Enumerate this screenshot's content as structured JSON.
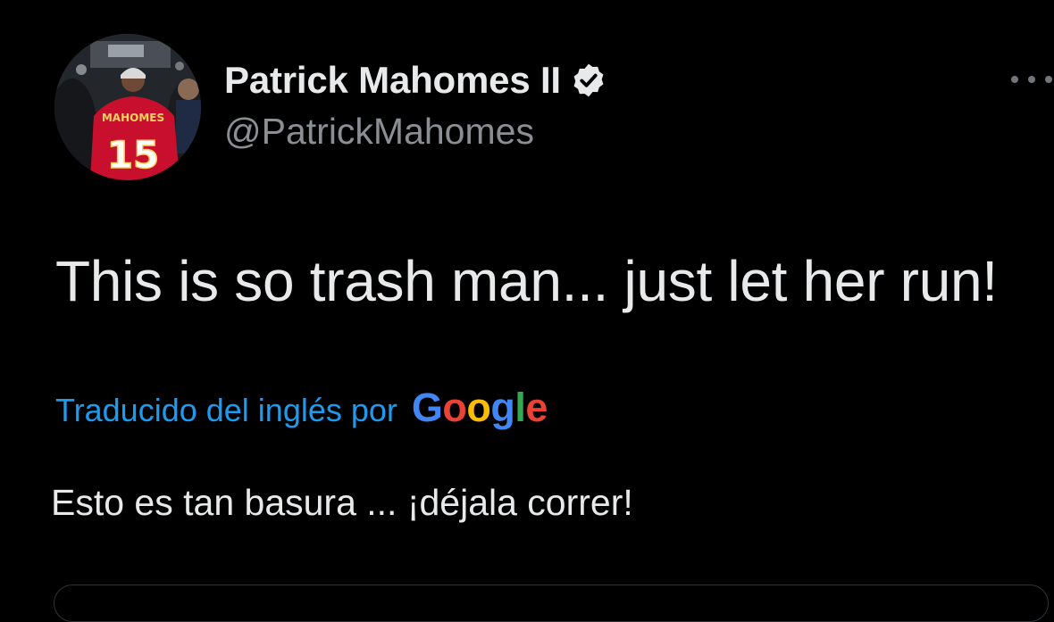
{
  "author": {
    "display_name": "Patrick Mahomes II",
    "handle": "@PatrickMahomes",
    "verified": true,
    "avatar": {
      "jersey_text": "MAHOMES",
      "jersey_number": "15"
    }
  },
  "tweet": {
    "text": "This is so trash man... just let her run!"
  },
  "translation": {
    "label": "Traducido del inglés por",
    "provider_letters": [
      "G",
      "o",
      "o",
      "g",
      "l",
      "e"
    ],
    "text": "Esto es tan basura ... ¡déjala correr!"
  },
  "icons": {
    "verified": "verified-badge-icon",
    "more": "more-options-icon"
  },
  "colors": {
    "background": "#000000",
    "primary_text": "#e7e9ea",
    "secondary_text": "#8b8f94",
    "link": "#1d9bf0",
    "google_blue": "#4285f4",
    "google_red": "#ea4335",
    "google_yellow": "#fbbc05",
    "google_green": "#34a853"
  }
}
